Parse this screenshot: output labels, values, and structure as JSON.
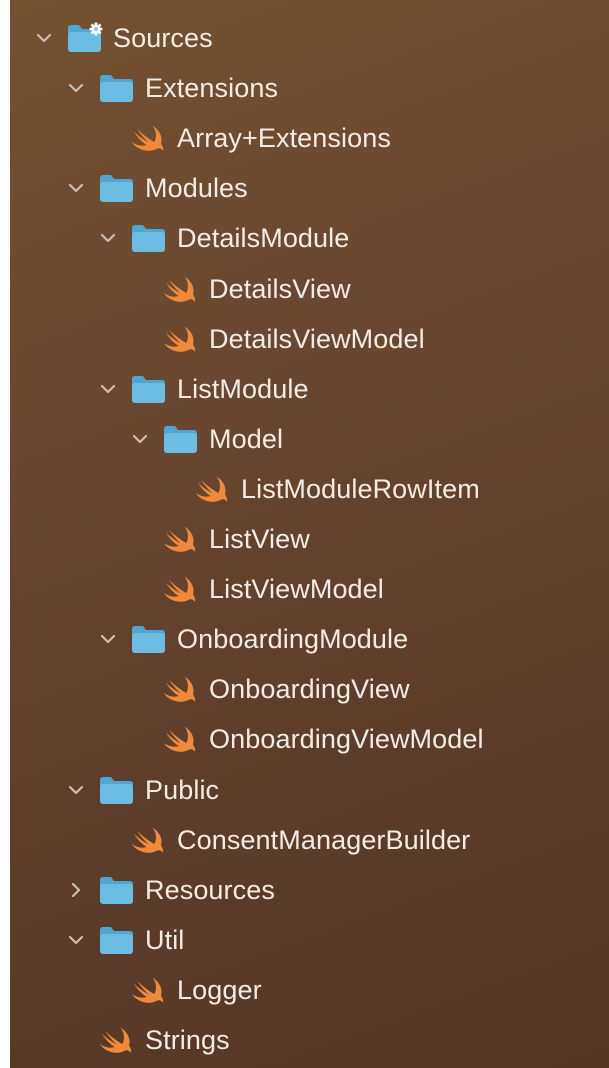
{
  "navigator": {
    "items": [
      {
        "id": "sources",
        "label": "Sources",
        "kind": "source-folder",
        "state": "expanded",
        "depth": 0,
        "icon": "folder-gear-icon"
      },
      {
        "id": "extensions",
        "label": "Extensions",
        "kind": "folder",
        "state": "expanded",
        "depth": 1,
        "icon": "folder-icon"
      },
      {
        "id": "array-extensions",
        "label": "Array+Extensions",
        "kind": "swift",
        "state": "leaf",
        "depth": 2,
        "icon": "swift-icon"
      },
      {
        "id": "modules",
        "label": "Modules",
        "kind": "folder",
        "state": "expanded",
        "depth": 1,
        "icon": "folder-icon"
      },
      {
        "id": "details-module",
        "label": "DetailsModule",
        "kind": "folder",
        "state": "expanded",
        "depth": 2,
        "icon": "folder-icon"
      },
      {
        "id": "details-view",
        "label": "DetailsView",
        "kind": "swift",
        "state": "leaf",
        "depth": 3,
        "icon": "swift-icon"
      },
      {
        "id": "details-view-model",
        "label": "DetailsViewModel",
        "kind": "swift",
        "state": "leaf",
        "depth": 3,
        "icon": "swift-icon"
      },
      {
        "id": "list-module",
        "label": "ListModule",
        "kind": "folder",
        "state": "expanded",
        "depth": 2,
        "icon": "folder-icon"
      },
      {
        "id": "model",
        "label": "Model",
        "kind": "folder",
        "state": "expanded",
        "depth": 3,
        "icon": "folder-icon"
      },
      {
        "id": "list-module-row-item",
        "label": "ListModuleRowItem",
        "kind": "swift",
        "state": "leaf",
        "depth": 4,
        "icon": "swift-icon"
      },
      {
        "id": "list-view",
        "label": "ListView",
        "kind": "swift",
        "state": "leaf",
        "depth": 3,
        "icon": "swift-icon"
      },
      {
        "id": "list-view-model",
        "label": "ListViewModel",
        "kind": "swift",
        "state": "leaf",
        "depth": 3,
        "icon": "swift-icon"
      },
      {
        "id": "onboarding-module",
        "label": "OnboardingModule",
        "kind": "folder",
        "state": "expanded",
        "depth": 2,
        "icon": "folder-icon"
      },
      {
        "id": "onboarding-view",
        "label": "OnboardingView",
        "kind": "swift",
        "state": "leaf",
        "depth": 3,
        "icon": "swift-icon"
      },
      {
        "id": "onboarding-view-model",
        "label": "OnboardingViewModel",
        "kind": "swift",
        "state": "leaf",
        "depth": 3,
        "icon": "swift-icon"
      },
      {
        "id": "public",
        "label": "Public",
        "kind": "folder",
        "state": "expanded",
        "depth": 1,
        "icon": "folder-icon"
      },
      {
        "id": "consent-manager-builder",
        "label": "ConsentManagerBuilder",
        "kind": "swift",
        "state": "leaf",
        "depth": 2,
        "icon": "swift-icon"
      },
      {
        "id": "resources",
        "label": "Resources",
        "kind": "folder",
        "state": "collapsed",
        "depth": 1,
        "icon": "folder-icon"
      },
      {
        "id": "util",
        "label": "Util",
        "kind": "folder",
        "state": "expanded",
        "depth": 1,
        "icon": "folder-icon"
      },
      {
        "id": "logger",
        "label": "Logger",
        "kind": "swift",
        "state": "leaf",
        "depth": 2,
        "icon": "swift-icon"
      },
      {
        "id": "strings",
        "label": "Strings",
        "kind": "swift",
        "state": "leaf",
        "depth": 1,
        "icon": "swift-icon"
      }
    ]
  },
  "colors": {
    "background_top": "#74512f",
    "background_bottom": "#553524",
    "text": "#f2ece6",
    "chevron": "#cdbfb2",
    "folder": "#6cbde4",
    "folder_dark": "#4fa6d2",
    "swift": "#f08a3a",
    "gear": "#ffffff"
  }
}
